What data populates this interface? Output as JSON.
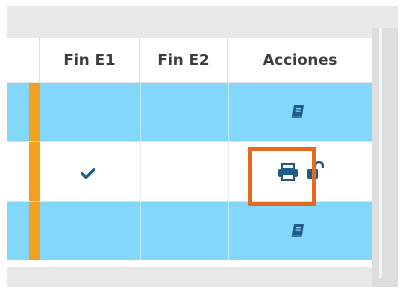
{
  "table": {
    "columns": [
      {
        "label": "Fin E1"
      },
      {
        "label": "Fin E2"
      },
      {
        "label": "Acciones"
      }
    ],
    "rows": [
      {
        "row_style": "highlighted-blue",
        "fin_e1_checked": false,
        "fin_e2_checked": false,
        "actions": [
          "book-icon"
        ]
      },
      {
        "row_style": "white",
        "fin_e1_checked": true,
        "fin_e2_checked": false,
        "actions": [
          "print-icon",
          "unlock-icon"
        ]
      },
      {
        "row_style": "highlighted-blue",
        "fin_e1_checked": false,
        "fin_e2_checked": false,
        "actions": [
          "book-icon"
        ]
      }
    ]
  },
  "colors": {
    "row_highlight": "#83d7fb",
    "status_marker": "#f39f1f",
    "icon_primary": "#1f5b86",
    "callout_border": "#e46a1d"
  }
}
